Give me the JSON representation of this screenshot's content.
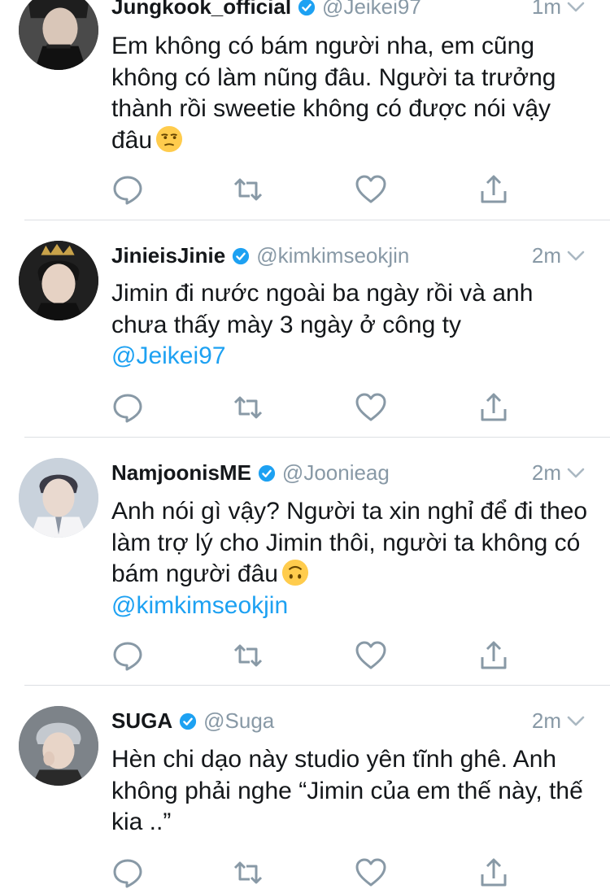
{
  "colors": {
    "link": "#1da1f2",
    "muted": "#8899a6",
    "verified": "#1da1f2"
  },
  "tweets": [
    {
      "name": "Jungkook_official",
      "handle": "@Jeikei97",
      "time": "1m",
      "text": "Em không có bám người nha, em cũng không có làm nũng đâu. Người ta trưởng thành rồi sweetie không có được nói vậy đâu",
      "emoji": "unamused-face-emoji",
      "mention": ""
    },
    {
      "name": "JinieisJinie",
      "handle": "@kimkimseokjin",
      "time": "2m",
      "text": "Jimin đi nước ngoài ba ngày rồi và anh chưa thấy mày 3 ngày ở công ty",
      "emoji": "",
      "mention": "@Jeikei97"
    },
    {
      "name": "NamjoonisME",
      "handle": "@Joonieag",
      "time": "2m",
      "text": "Anh nói gì vậy? Người ta xin nghỉ để đi theo làm trợ lý cho Jimin thôi, người ta không có bám người đâu",
      "emoji": "upside-down-face-emoji",
      "mention": "@kimkimseokjin"
    },
    {
      "name": "SUGA",
      "handle": "@Suga",
      "time": "2m",
      "text": "Hèn chi dạo này studio yên tĩnh ghê. Anh không phải nghe “Jimin của em thế này, thế kia ..”",
      "emoji": "",
      "mention": ""
    }
  ],
  "icons": {
    "reply": "reply-icon",
    "retweet": "retweet-icon",
    "like": "heart-icon",
    "share": "share-icon",
    "menu": "chevron-down-icon",
    "verified": "verified-badge-icon"
  }
}
